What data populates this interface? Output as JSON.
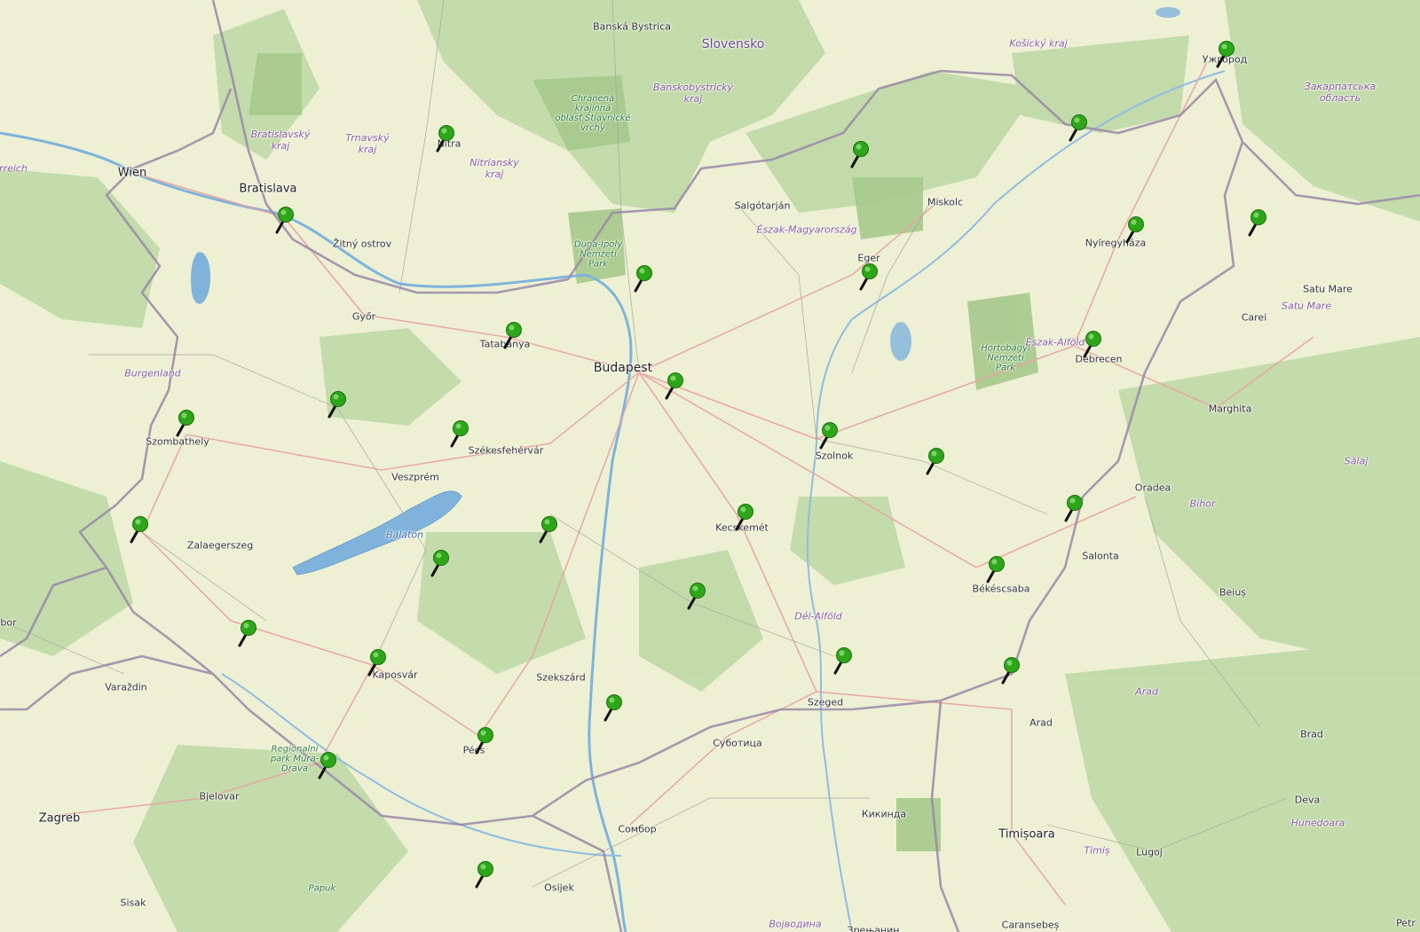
{
  "map": {
    "colors": {
      "land": "#eef0d4",
      "forest": "#b9d6a0",
      "water": "#7fb3dc",
      "border": "#9a88a8",
      "road": "#e0a0a0",
      "marker": "#2ea61a"
    },
    "labels": [
      {
        "id": "banska-bystrica",
        "text": "Banská Bystrica",
        "cls": "city"
      },
      {
        "id": "slovensko",
        "text": "Slovensko",
        "cls": "country"
      },
      {
        "id": "kosicky-kraj",
        "text": "Košický kraj",
        "cls": "region"
      },
      {
        "id": "uzhhorod",
        "text": "Ужгород",
        "cls": "city"
      },
      {
        "id": "zakarpatska",
        "text": "Закарпатська\nобласть",
        "cls": "region"
      },
      {
        "id": "bratislavsky-kraj",
        "text": "Bratislavský\nkraj",
        "cls": "region"
      },
      {
        "id": "trnavsky-kraj",
        "text": "Trnavský\nkraj",
        "cls": "region"
      },
      {
        "id": "nitra",
        "text": "Nitra",
        "cls": "city"
      },
      {
        "id": "nitriansky-kraj",
        "text": "Nitriansky\nkraj",
        "cls": "region"
      },
      {
        "id": "chranena-krajina",
        "text": "Chránená\nkrajinná\noblasť Štiavnické\nvrchy",
        "cls": "park"
      },
      {
        "id": "banskobystricky-kraj",
        "text": "Banskobystrický\nkraj",
        "cls": "region"
      },
      {
        "id": "wien",
        "text": "Wien",
        "cls": "big"
      },
      {
        "id": "bratislava",
        "text": "Bratislava",
        "cls": "big"
      },
      {
        "id": "zitny-ostrov",
        "text": "Žitný ostrov",
        "cls": "city"
      },
      {
        "id": "salgotarjan",
        "text": "Salgótarján",
        "cls": "city"
      },
      {
        "id": "miskolc",
        "text": "Miskolc",
        "cls": "city"
      },
      {
        "id": "eszak-magyarorszag",
        "text": "Észak-Magyarország",
        "cls": "region"
      },
      {
        "id": "nyiregyhaza",
        "text": "Nyíregyháza",
        "cls": "city"
      },
      {
        "id": "satu-mare",
        "text": "Satu Mare",
        "cls": "city"
      },
      {
        "id": "satu-mare-region",
        "text": "Satu Mare",
        "cls": "region"
      },
      {
        "id": "carei",
        "text": "Carei",
        "cls": "city"
      },
      {
        "id": "duna-ipoly",
        "text": "Duna-Ipoly\nNemzeti\nPark",
        "cls": "park"
      },
      {
        "id": "eger",
        "text": "Eger",
        "cls": "city"
      },
      {
        "id": "gyor",
        "text": "Győr",
        "cls": "city"
      },
      {
        "id": "tatabanya",
        "text": "Tatabánya",
        "cls": "city"
      },
      {
        "id": "budapest",
        "text": "Budapest",
        "cls": "capital"
      },
      {
        "id": "hortobagyi",
        "text": "Hortobágyi\nNemzeti\nPark",
        "cls": "park"
      },
      {
        "id": "eszak-alfold",
        "text": "Észak-Alföld",
        "cls": "region"
      },
      {
        "id": "debrecen",
        "text": "Debrecen",
        "cls": "city"
      },
      {
        "id": "burgenland",
        "text": "Burgenland",
        "cls": "region"
      },
      {
        "id": "szombathely",
        "text": "Szombathely",
        "cls": "city"
      },
      {
        "id": "szekesfehervar",
        "text": "Székesfehérvár",
        "cls": "city"
      },
      {
        "id": "veszprem",
        "text": "Veszprém",
        "cls": "city"
      },
      {
        "id": "szolnok",
        "text": "Szolnok",
        "cls": "city"
      },
      {
        "id": "marghita",
        "text": "Marghita",
        "cls": "city"
      },
      {
        "id": "salaj",
        "text": "Sălaj",
        "cls": "region"
      },
      {
        "id": "oradea",
        "text": "Oradea",
        "cls": "city"
      },
      {
        "id": "bihor",
        "text": "Bihor",
        "cls": "region"
      },
      {
        "id": "zalaegerszeg",
        "text": "Zalaegerszeg",
        "cls": "city"
      },
      {
        "id": "balaton",
        "text": "Balaton",
        "cls": "lake"
      },
      {
        "id": "kecskemet",
        "text": "Kecskemét",
        "cls": "city"
      },
      {
        "id": "salonta",
        "text": "Salonta",
        "cls": "city"
      },
      {
        "id": "bekescsaba",
        "text": "Békéscsaba",
        "cls": "city"
      },
      {
        "id": "beius",
        "text": "Beiuș",
        "cls": "city"
      },
      {
        "id": "del-alfold",
        "text": "Dél-Alföld",
        "cls": "region"
      },
      {
        "id": "kaposvar",
        "text": "Kaposvár",
        "cls": "city"
      },
      {
        "id": "szekszard",
        "text": "Szekszárd",
        "cls": "city"
      },
      {
        "id": "varazdin",
        "text": "Varaždin",
        "cls": "city"
      },
      {
        "id": "szeged",
        "text": "Szeged",
        "cls": "city"
      },
      {
        "id": "arad-region",
        "text": "Arad",
        "cls": "region"
      },
      {
        "id": "arad",
        "text": "Arad",
        "cls": "city"
      },
      {
        "id": "subotica",
        "text": "Суботица",
        "cls": "city"
      },
      {
        "id": "brad",
        "text": "Brad",
        "cls": "city"
      },
      {
        "id": "regionalni-park",
        "text": "Regionalni\npark Mura-\nDrava",
        "cls": "park"
      },
      {
        "id": "pecs",
        "text": "Pécs",
        "cls": "city"
      },
      {
        "id": "bjelovar",
        "text": "Bjelovar",
        "cls": "city"
      },
      {
        "id": "deva",
        "text": "Deva",
        "cls": "city"
      },
      {
        "id": "zagreb",
        "text": "Zagreb",
        "cls": "big"
      },
      {
        "id": "sombor",
        "text": "Сомбор",
        "cls": "city"
      },
      {
        "id": "kikinda",
        "text": "Кикинда",
        "cls": "city"
      },
      {
        "id": "timisoara",
        "text": "Timișoara",
        "cls": "big"
      },
      {
        "id": "hunedoara",
        "text": "Hunedoara",
        "cls": "region"
      },
      {
        "id": "timis",
        "text": "Timiș",
        "cls": "region"
      },
      {
        "id": "lugoj",
        "text": "Lugoj",
        "cls": "city"
      },
      {
        "id": "sisak",
        "text": "Sisak",
        "cls": "city"
      },
      {
        "id": "papuk",
        "text": "Papuk",
        "cls": "park"
      },
      {
        "id": "osijek",
        "text": "Osijek",
        "cls": "city"
      },
      {
        "id": "vojvodina",
        "text": "Војводина",
        "cls": "region"
      },
      {
        "id": "zrenjanin",
        "text": "Зрењанин",
        "cls": "city"
      },
      {
        "id": "caransebes",
        "text": "Caransebeș",
        "cls": "city"
      },
      {
        "id": "petr",
        "text": "Petr",
        "cls": "city"
      },
      {
        "id": "reich",
        "text": "rreich",
        "cls": "region"
      },
      {
        "id": "ibor",
        "text": "ibor",
        "cls": "city"
      }
    ],
    "markers": [
      {
        "id": "uzhhorod"
      },
      {
        "id": "nitra"
      },
      {
        "id": "kosice-area"
      },
      {
        "id": "north-borsod"
      },
      {
        "id": "bratislava-south"
      },
      {
        "id": "nyiregyhaza"
      },
      {
        "id": "satu-mare-west"
      },
      {
        "id": "vac"
      },
      {
        "id": "eger"
      },
      {
        "id": "tatabanya"
      },
      {
        "id": "debrecen"
      },
      {
        "id": "budapest-east"
      },
      {
        "id": "papa"
      },
      {
        "id": "szombathely"
      },
      {
        "id": "szekesfehervar"
      },
      {
        "id": "szolnok"
      },
      {
        "id": "karcag-south"
      },
      {
        "id": "berettyoujfalu"
      },
      {
        "id": "zala-west"
      },
      {
        "id": "dunaujvaros"
      },
      {
        "id": "kecskemet"
      },
      {
        "id": "siofok-south"
      },
      {
        "id": "bekescsaba"
      },
      {
        "id": "kiskunfelegyhaza"
      },
      {
        "id": "nagykanizsa"
      },
      {
        "id": "kaposvar"
      },
      {
        "id": "hodmezovasarhely"
      },
      {
        "id": "gyula"
      },
      {
        "id": "baja"
      },
      {
        "id": "pecs"
      },
      {
        "id": "barcs"
      },
      {
        "id": "osijek-area"
      }
    ]
  }
}
